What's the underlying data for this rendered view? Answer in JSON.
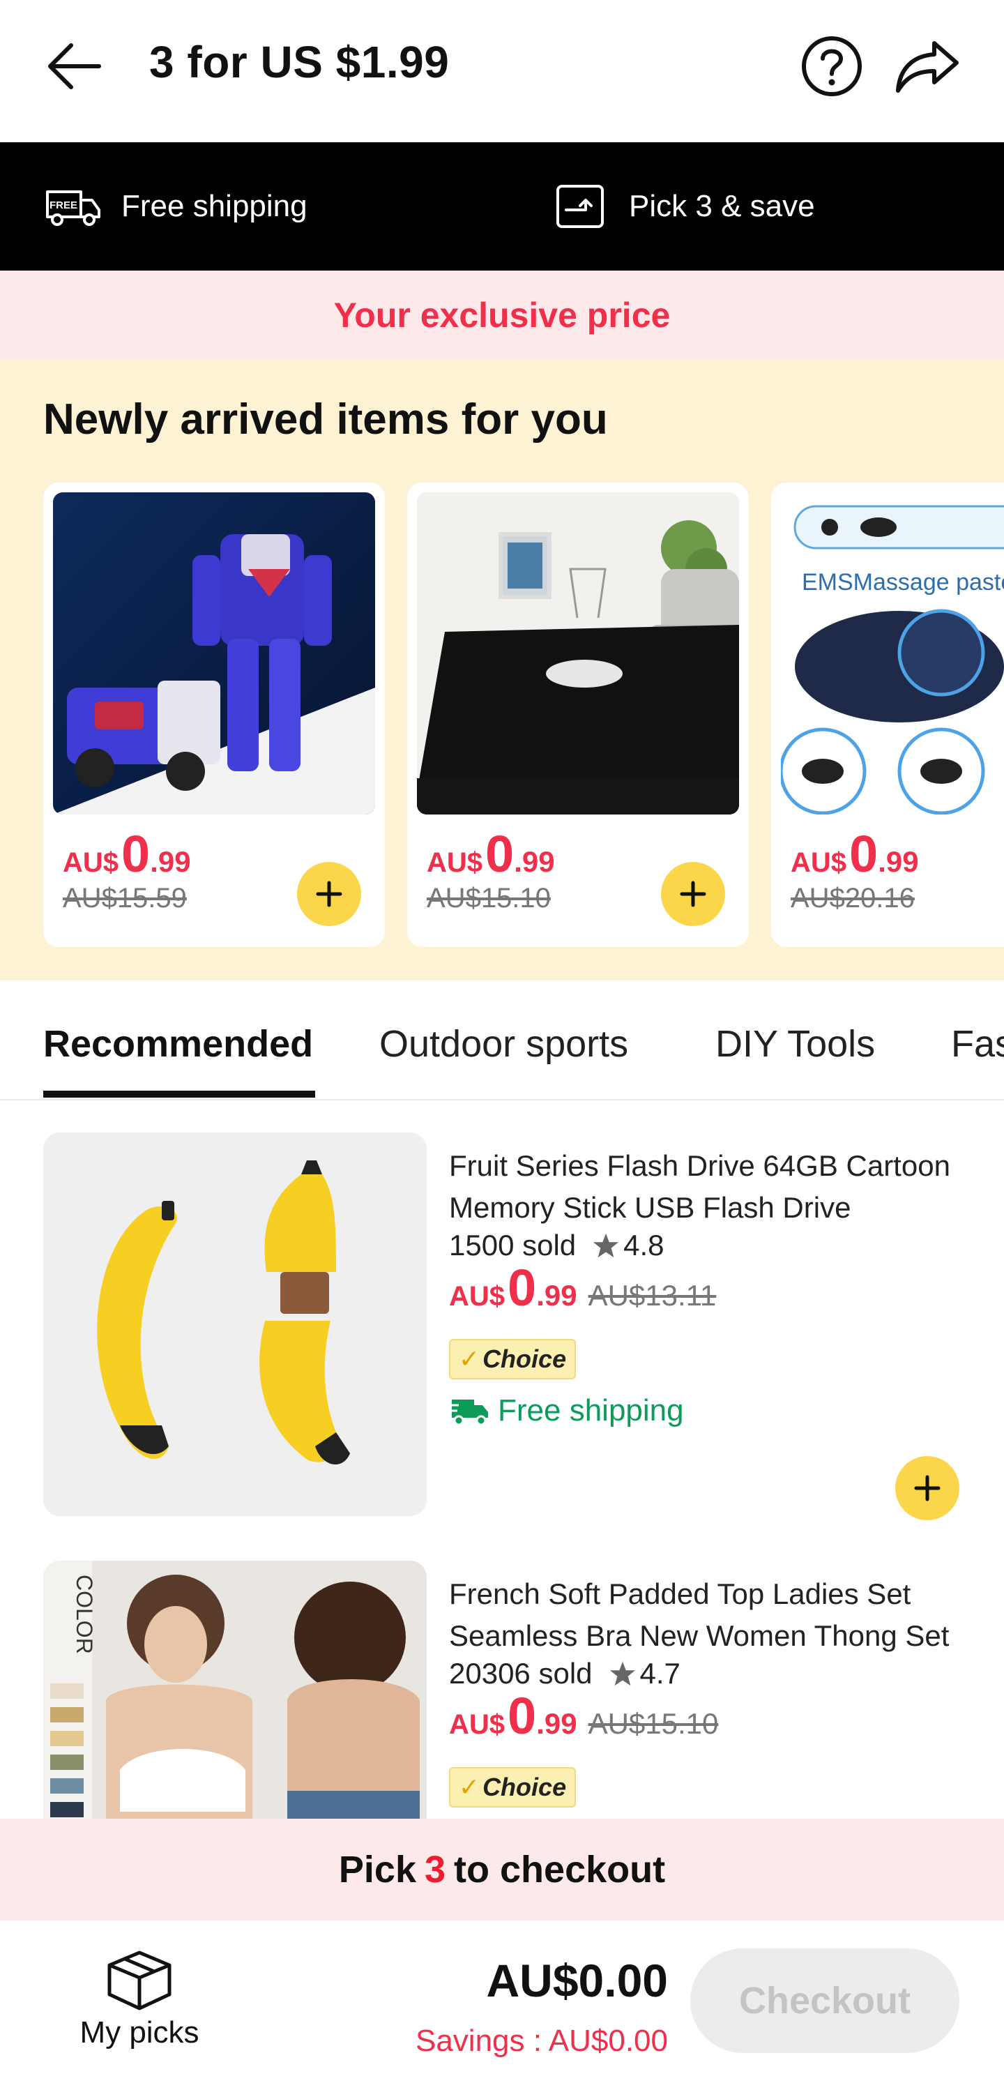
{
  "header": {
    "title": "3 for US $1.99",
    "back_icon": "arrow-left-icon",
    "help_icon": "question-circle-icon",
    "share_icon": "share-arrow-icon"
  },
  "benefits": {
    "free_shipping": "Free shipping",
    "pick_save": "Pick 3 & save",
    "free_badge": "FREE"
  },
  "exclusive_banner": "Your exclusive price",
  "newly_arrived": {
    "title": "Newly arrived items for you",
    "items": [
      {
        "currency": "AU$",
        "price_int": "0",
        "price_dec": ".99",
        "original": "AU$15.59",
        "image": "robot-toy"
      },
      {
        "currency": "AU$",
        "price_int": "0",
        "price_dec": ".99",
        "original": "AU$15.10",
        "image": "black-rug"
      },
      {
        "currency": "AU$",
        "price_int": "0",
        "price_dec": ".99",
        "original": "AU$20.16",
        "image": "ems-massager",
        "image_text": "EMSMassage paste"
      }
    ]
  },
  "tabs": [
    "Recommended",
    "Outdoor sports",
    "DIY Tools",
    "Fas"
  ],
  "active_tab": "Recommended",
  "products": [
    {
      "title": "Fruit Series Flash Drive 64GB Cartoon Memory Stick USB Flash Drive",
      "sold": "1500 sold",
      "rating": "4.8",
      "currency": "AU$",
      "price_int": "0",
      "price_dec": ".99",
      "original": "AU$13.11",
      "badge": "Choice",
      "shipping": "Free shipping"
    },
    {
      "title": "French Soft Padded Top Ladies Set Seamless Bra New Women Thong Set",
      "sold": "20306 sold",
      "rating": "4.7",
      "currency": "AU$",
      "price_int": "0",
      "price_dec": ".99",
      "original": "AU$15.10",
      "badge": "Choice",
      "image_text": "COLOR"
    }
  ],
  "pick_bar": {
    "prefix": "Pick",
    "count": "3",
    "suffix": "to checkout"
  },
  "bottom": {
    "my_picks": "My picks",
    "total": "AU$0.00",
    "savings": "Savings : AU$0.00",
    "checkout": "Checkout"
  },
  "colors": {
    "accent_red": "#f0304a",
    "add_button": "#fbd64a",
    "newly_bg": "#fdf3d4",
    "banner_bg": "#fde8ea",
    "free_shipping_green": "#0d9b5a"
  }
}
